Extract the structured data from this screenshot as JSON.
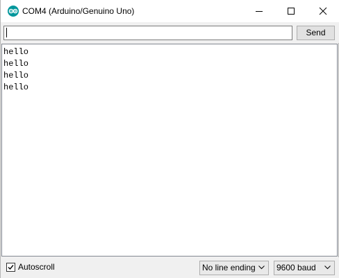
{
  "window": {
    "title": "COM4 (Arduino/Genuino Uno)",
    "icon": "arduino-logo-icon",
    "accent_color": "#00979c"
  },
  "controls": {
    "minimize_icon": "minimize-icon",
    "maximize_icon": "maximize-icon",
    "close_icon": "close-icon"
  },
  "input": {
    "value": "",
    "send_label": "Send"
  },
  "output": {
    "lines": [
      "hello",
      "hello",
      "hello",
      "hello"
    ]
  },
  "footer": {
    "autoscroll_label": "Autoscroll",
    "autoscroll_checked": true,
    "line_ending_selected": "No line ending",
    "baud_selected": "9600 baud"
  }
}
